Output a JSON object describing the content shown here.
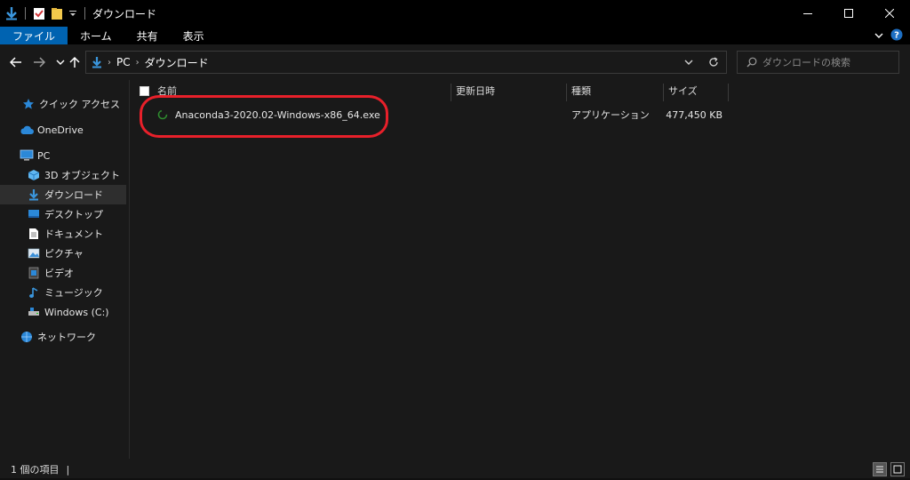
{
  "window": {
    "title": "ダウンロード",
    "controls": {
      "minimize": "—",
      "maximize": "☐",
      "close": "✕"
    }
  },
  "ribbon": {
    "tabs": [
      {
        "label": "ファイル",
        "active": true
      },
      {
        "label": "ホーム",
        "active": false
      },
      {
        "label": "共有",
        "active": false
      },
      {
        "label": "表示",
        "active": false
      }
    ]
  },
  "address": {
    "parts": [
      "PC",
      "ダウンロード"
    ],
    "refresh_icon": "refresh-icon",
    "dropdown_icon": "chevron-down-icon"
  },
  "search": {
    "placeholder": "ダウンロードの検索"
  },
  "sidebar": {
    "items": [
      {
        "label": "クイック アクセス",
        "icon": "star-icon"
      },
      {
        "label": "OneDrive",
        "icon": "cloud-icon"
      },
      {
        "label": "PC",
        "icon": "pc-icon"
      },
      {
        "label": "3D オブジェクト",
        "icon": "cube-icon"
      },
      {
        "label": "ダウンロード",
        "icon": "download-icon",
        "selected": true
      },
      {
        "label": "デスクトップ",
        "icon": "desktop-icon"
      },
      {
        "label": "ドキュメント",
        "icon": "document-icon"
      },
      {
        "label": "ピクチャ",
        "icon": "picture-icon"
      },
      {
        "label": "ビデオ",
        "icon": "video-icon"
      },
      {
        "label": "ミュージック",
        "icon": "music-icon"
      },
      {
        "label": "Windows (C:)",
        "icon": "drive-icon"
      },
      {
        "label": "ネットワーク",
        "icon": "network-icon"
      }
    ]
  },
  "table": {
    "columns": [
      "名前",
      "更新日時",
      "種類",
      "サイズ"
    ],
    "rows": [
      {
        "name": "Anaconda3-2020.02-Windows-x86_64.exe",
        "modified": "",
        "type": "アプリケーション",
        "size": "477,450 KB"
      }
    ]
  },
  "status": {
    "count": "1 個の項目",
    "separator": "|"
  },
  "colors": {
    "accent": "#0063b1",
    "highlight": "#e8202a",
    "background": "#191919",
    "titlebar": "#000000"
  }
}
